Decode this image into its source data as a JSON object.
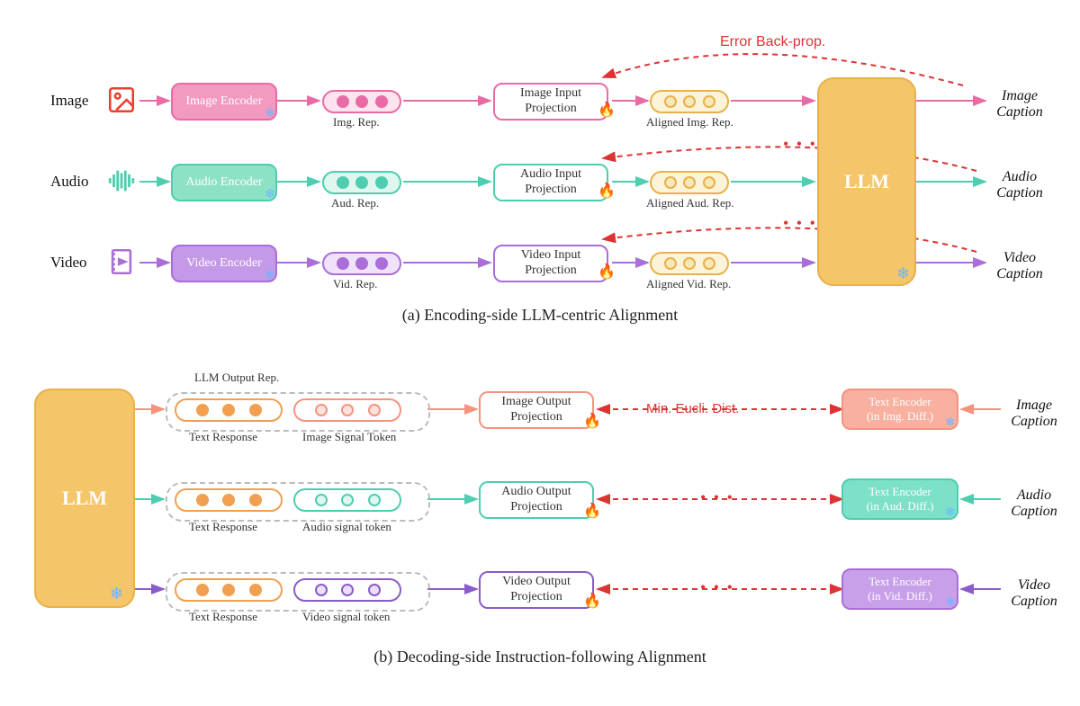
{
  "section_a": {
    "caption": "(a) Encoding-side LLM-centric Alignment",
    "error_label": "Error Back-prop.",
    "llm_label": "LLM",
    "rows": {
      "image": {
        "label": "Image",
        "encoder": "Image Encoder",
        "rep_label": "Img. Rep.",
        "projection": "Image Input Projection",
        "aligned_label": "Aligned Img. Rep.",
        "output": "Image Caption"
      },
      "audio": {
        "label": "Audio",
        "encoder": "Audio Encoder",
        "rep_label": "Aud. Rep.",
        "projection": "Audio Input Projection",
        "aligned_label": "Aligned Aud. Rep.",
        "output": "Audio Caption"
      },
      "video": {
        "label": "Video",
        "encoder": "Video Encoder",
        "rep_label": "Vid. Rep.",
        "projection": "Video Input Projection",
        "aligned_label": "Aligned Vid. Rep.",
        "output": "Video Caption"
      }
    }
  },
  "section_b": {
    "caption": "(b) Decoding-side Instruction-following Alignment",
    "llm_label": "LLM",
    "llm_output_label": "LLM Output Rep.",
    "dist_label": "Min. Eucli. Dist.",
    "rows": {
      "image": {
        "text_resp": "Text Response",
        "signal_label": "Image Signal Token",
        "projection": "Image Output Projection",
        "text_encoder": "Text Encoder",
        "diff_label": "(in Img. Diff.)",
        "input": "Image Caption"
      },
      "audio": {
        "text_resp": "Text Response",
        "signal_label": "Audio signal token",
        "projection": "Audio Output Projection",
        "text_encoder": "Text Encoder",
        "diff_label": "(in Aud. Diff.)",
        "input": "Audio Caption"
      },
      "video": {
        "text_resp": "Text Response",
        "signal_label": "Video signal token",
        "projection": "Video Output Projection",
        "text_encoder": "Text Encoder",
        "diff_label": "(in Vid. Diff.)",
        "input": "Video Caption"
      }
    }
  },
  "colors": {
    "pink": "#e96ba6",
    "green": "#4ecdb0",
    "purple": "#a96ed8",
    "orange_llm": "#f5c56a",
    "red": "#d33"
  }
}
